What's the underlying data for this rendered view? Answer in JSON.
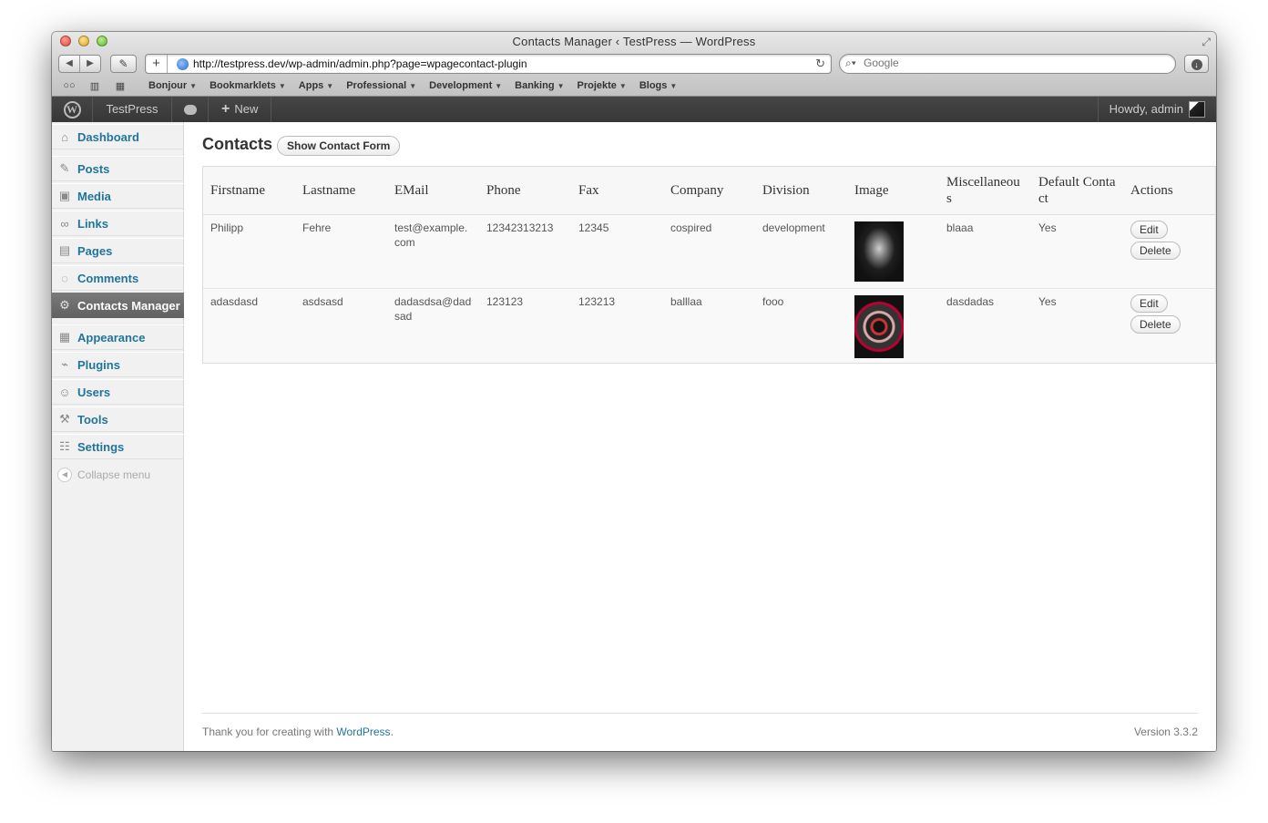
{
  "window": {
    "title": "Contacts Manager ‹ TestPress — WordPress"
  },
  "browser": {
    "url": "http://testpress.dev/wp-admin/admin.php?page=wpagecontact-plugin",
    "search_placeholder": "Google",
    "bookmarks": [
      "Bonjour",
      "Bookmarklets",
      "Apps",
      "Professional",
      "Development",
      "Banking",
      "Projekte",
      "Blogs"
    ]
  },
  "adminbar": {
    "site": "TestPress",
    "new": "New",
    "howdy": "Howdy, admin"
  },
  "sidebar": {
    "items": [
      {
        "label": "Dashboard",
        "icon": "dashboard-icon"
      },
      {
        "label": "Posts",
        "icon": "pushpin-icon"
      },
      {
        "label": "Media",
        "icon": "media-icon"
      },
      {
        "label": "Links",
        "icon": "link-icon"
      },
      {
        "label": "Pages",
        "icon": "pages-icon"
      },
      {
        "label": "Comments",
        "icon": "comment-icon"
      },
      {
        "label": "Contacts Manager",
        "icon": "gear-icon",
        "current": true
      },
      {
        "label": "Appearance",
        "icon": "appearance-icon"
      },
      {
        "label": "Plugins",
        "icon": "plugin-icon"
      },
      {
        "label": "Users",
        "icon": "users-icon"
      },
      {
        "label": "Tools",
        "icon": "tools-icon"
      },
      {
        "label": "Settings",
        "icon": "settings-icon"
      }
    ],
    "collapse": "Collapse menu"
  },
  "main": {
    "title": "Contacts",
    "show_form_button": "Show Contact Form",
    "table": {
      "headers": [
        "Firstname",
        "Lastname",
        "EMail",
        "Phone",
        "Fax",
        "Company",
        "Division",
        "Image",
        "Miscellaneous",
        "Default Contact",
        "Actions"
      ],
      "rows": [
        {
          "firstname": "Philipp",
          "lastname": "Fehre",
          "email": "test@example.com",
          "phone": "12342313213",
          "fax": "12345",
          "company": "cospired",
          "division": "development",
          "misc": "blaaa",
          "default": "Yes",
          "edit": "Edit",
          "delete": "Delete"
        },
        {
          "firstname": "adasdasd",
          "lastname": "asdsasd",
          "email": "dadasdsa@dadsad",
          "phone": "123123",
          "fax": "123213",
          "company": "balllaa",
          "division": "fooo",
          "misc": "dasdadas",
          "default": "Yes",
          "edit": "Edit",
          "delete": "Delete"
        }
      ]
    }
  },
  "footer": {
    "thanks": "Thank you for creating with",
    "link": "WordPress",
    "period": ".",
    "version": "Version 3.3.2"
  },
  "colors": {
    "accent": "#21759b",
    "adminbar": "#464646",
    "current_menu": "#6d6d6d"
  }
}
